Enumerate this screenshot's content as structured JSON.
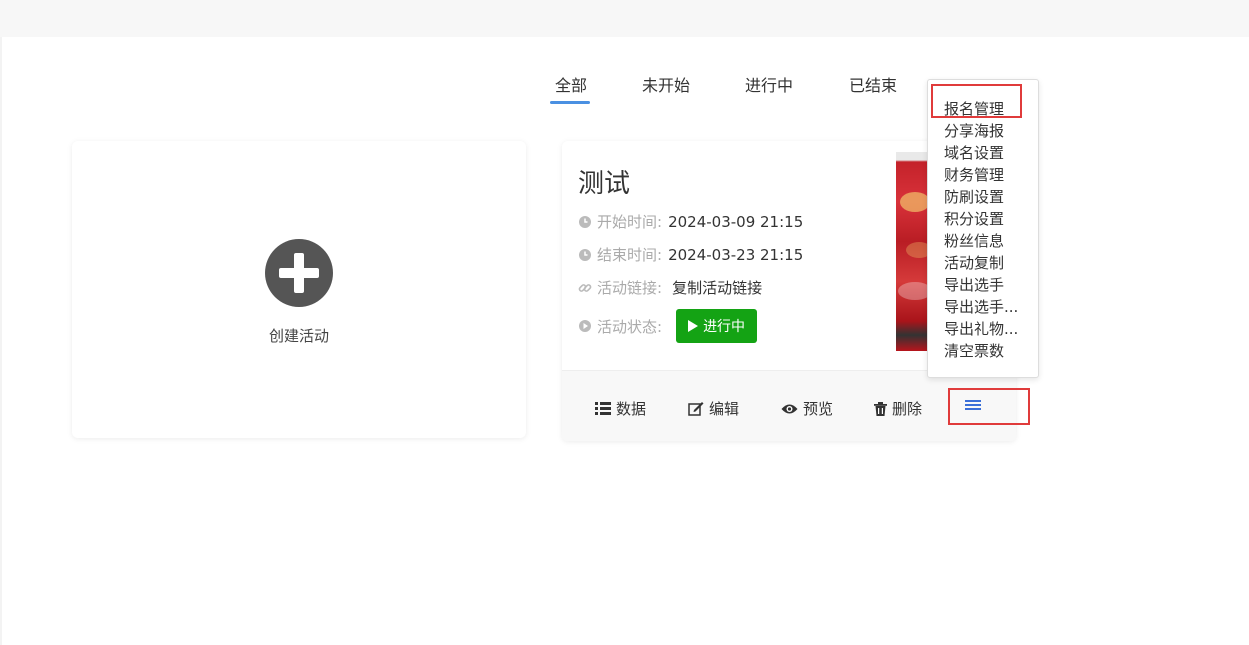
{
  "tabs": [
    {
      "label": "全部",
      "active": true
    },
    {
      "label": "未开始",
      "active": false
    },
    {
      "label": "进行中",
      "active": false
    },
    {
      "label": "已结束",
      "active": false
    }
  ],
  "create": {
    "label": "创建活动"
  },
  "activity": {
    "title": "测试",
    "start_label": "开始时间:",
    "start_value": "2024-03-09 21:15",
    "end_label": "结束时间:",
    "end_value": "2024-03-23 21:15",
    "link_label": "活动链接:",
    "link_value": "复制活动链接",
    "status_label": "活动状态:",
    "status_value": "进行中"
  },
  "footer": {
    "data_label": "数据",
    "edit_label": "编辑",
    "preview_label": "预览",
    "delete_label": "删除"
  },
  "dropdown": {
    "items": [
      "报名管理",
      "分享海报",
      "域名设置",
      "财务管理",
      "防刷设置",
      "积分设置",
      "粉丝信息",
      "活动复制",
      "导出选手",
      "导出选手...",
      "导出礼物...",
      "清空票数"
    ]
  },
  "colors": {
    "accent": "#4a90e2",
    "status_green": "#14a314",
    "highlight_red": "#e03b3b"
  }
}
